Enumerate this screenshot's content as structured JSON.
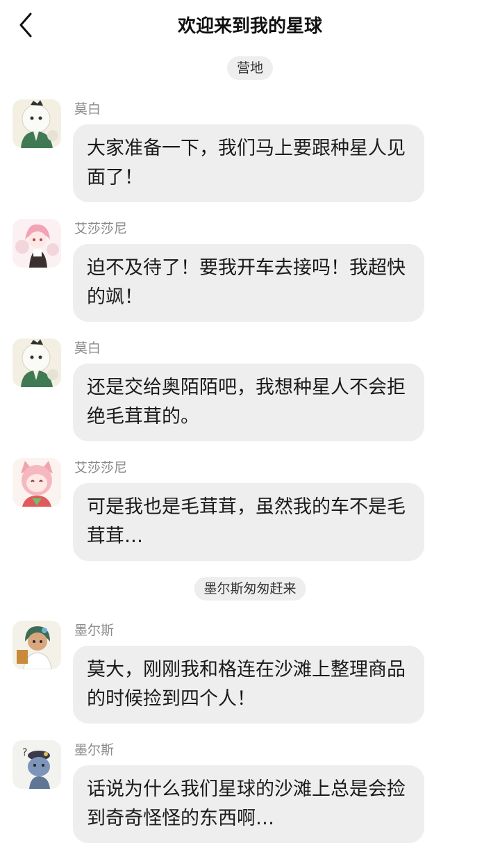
{
  "header": {
    "title": "欢迎来到我的星球",
    "back_icon": "chevron-left-icon"
  },
  "dividers": [
    {
      "label": "营地"
    },
    {
      "label": "墨尔斯匆匆赶来"
    }
  ],
  "messages": [
    {
      "sender": "莫白",
      "text": "大家准备一下，我们马上要跟种星人见面了！",
      "avatar": "white-lion-avatar"
    },
    {
      "sender": "艾莎莎尼",
      "text": "迫不及待了！要我开车去接吗！我超快的飒！",
      "avatar": "pink-girl-avatar"
    },
    {
      "sender": "莫白",
      "text": "还是交给奥陌陌吧，我想种星人不会拒绝毛茸茸的。",
      "avatar": "white-lion-avatar"
    },
    {
      "sender": "艾莎莎尼",
      "text": "可是我也是毛茸茸，虽然我的车不是毛茸茸…",
      "avatar": "pink-cat-avatar"
    },
    {
      "sender": "墨尔斯",
      "text": "莫大，刚刚我和格连在沙滩上整理商品的时候捡到四个人！",
      "avatar": "green-hair-boy-avatar"
    },
    {
      "sender": "墨尔斯",
      "text": "话说为什么我们星球的沙滩上总是会捡到奇奇怪怪的东西啊…",
      "avatar": "blue-creature-avatar"
    }
  ],
  "colors": {
    "background": "#ffffff",
    "bubble": "#eeeeee",
    "pill": "#eeeeee",
    "sender_text": "#8a8a8a"
  }
}
